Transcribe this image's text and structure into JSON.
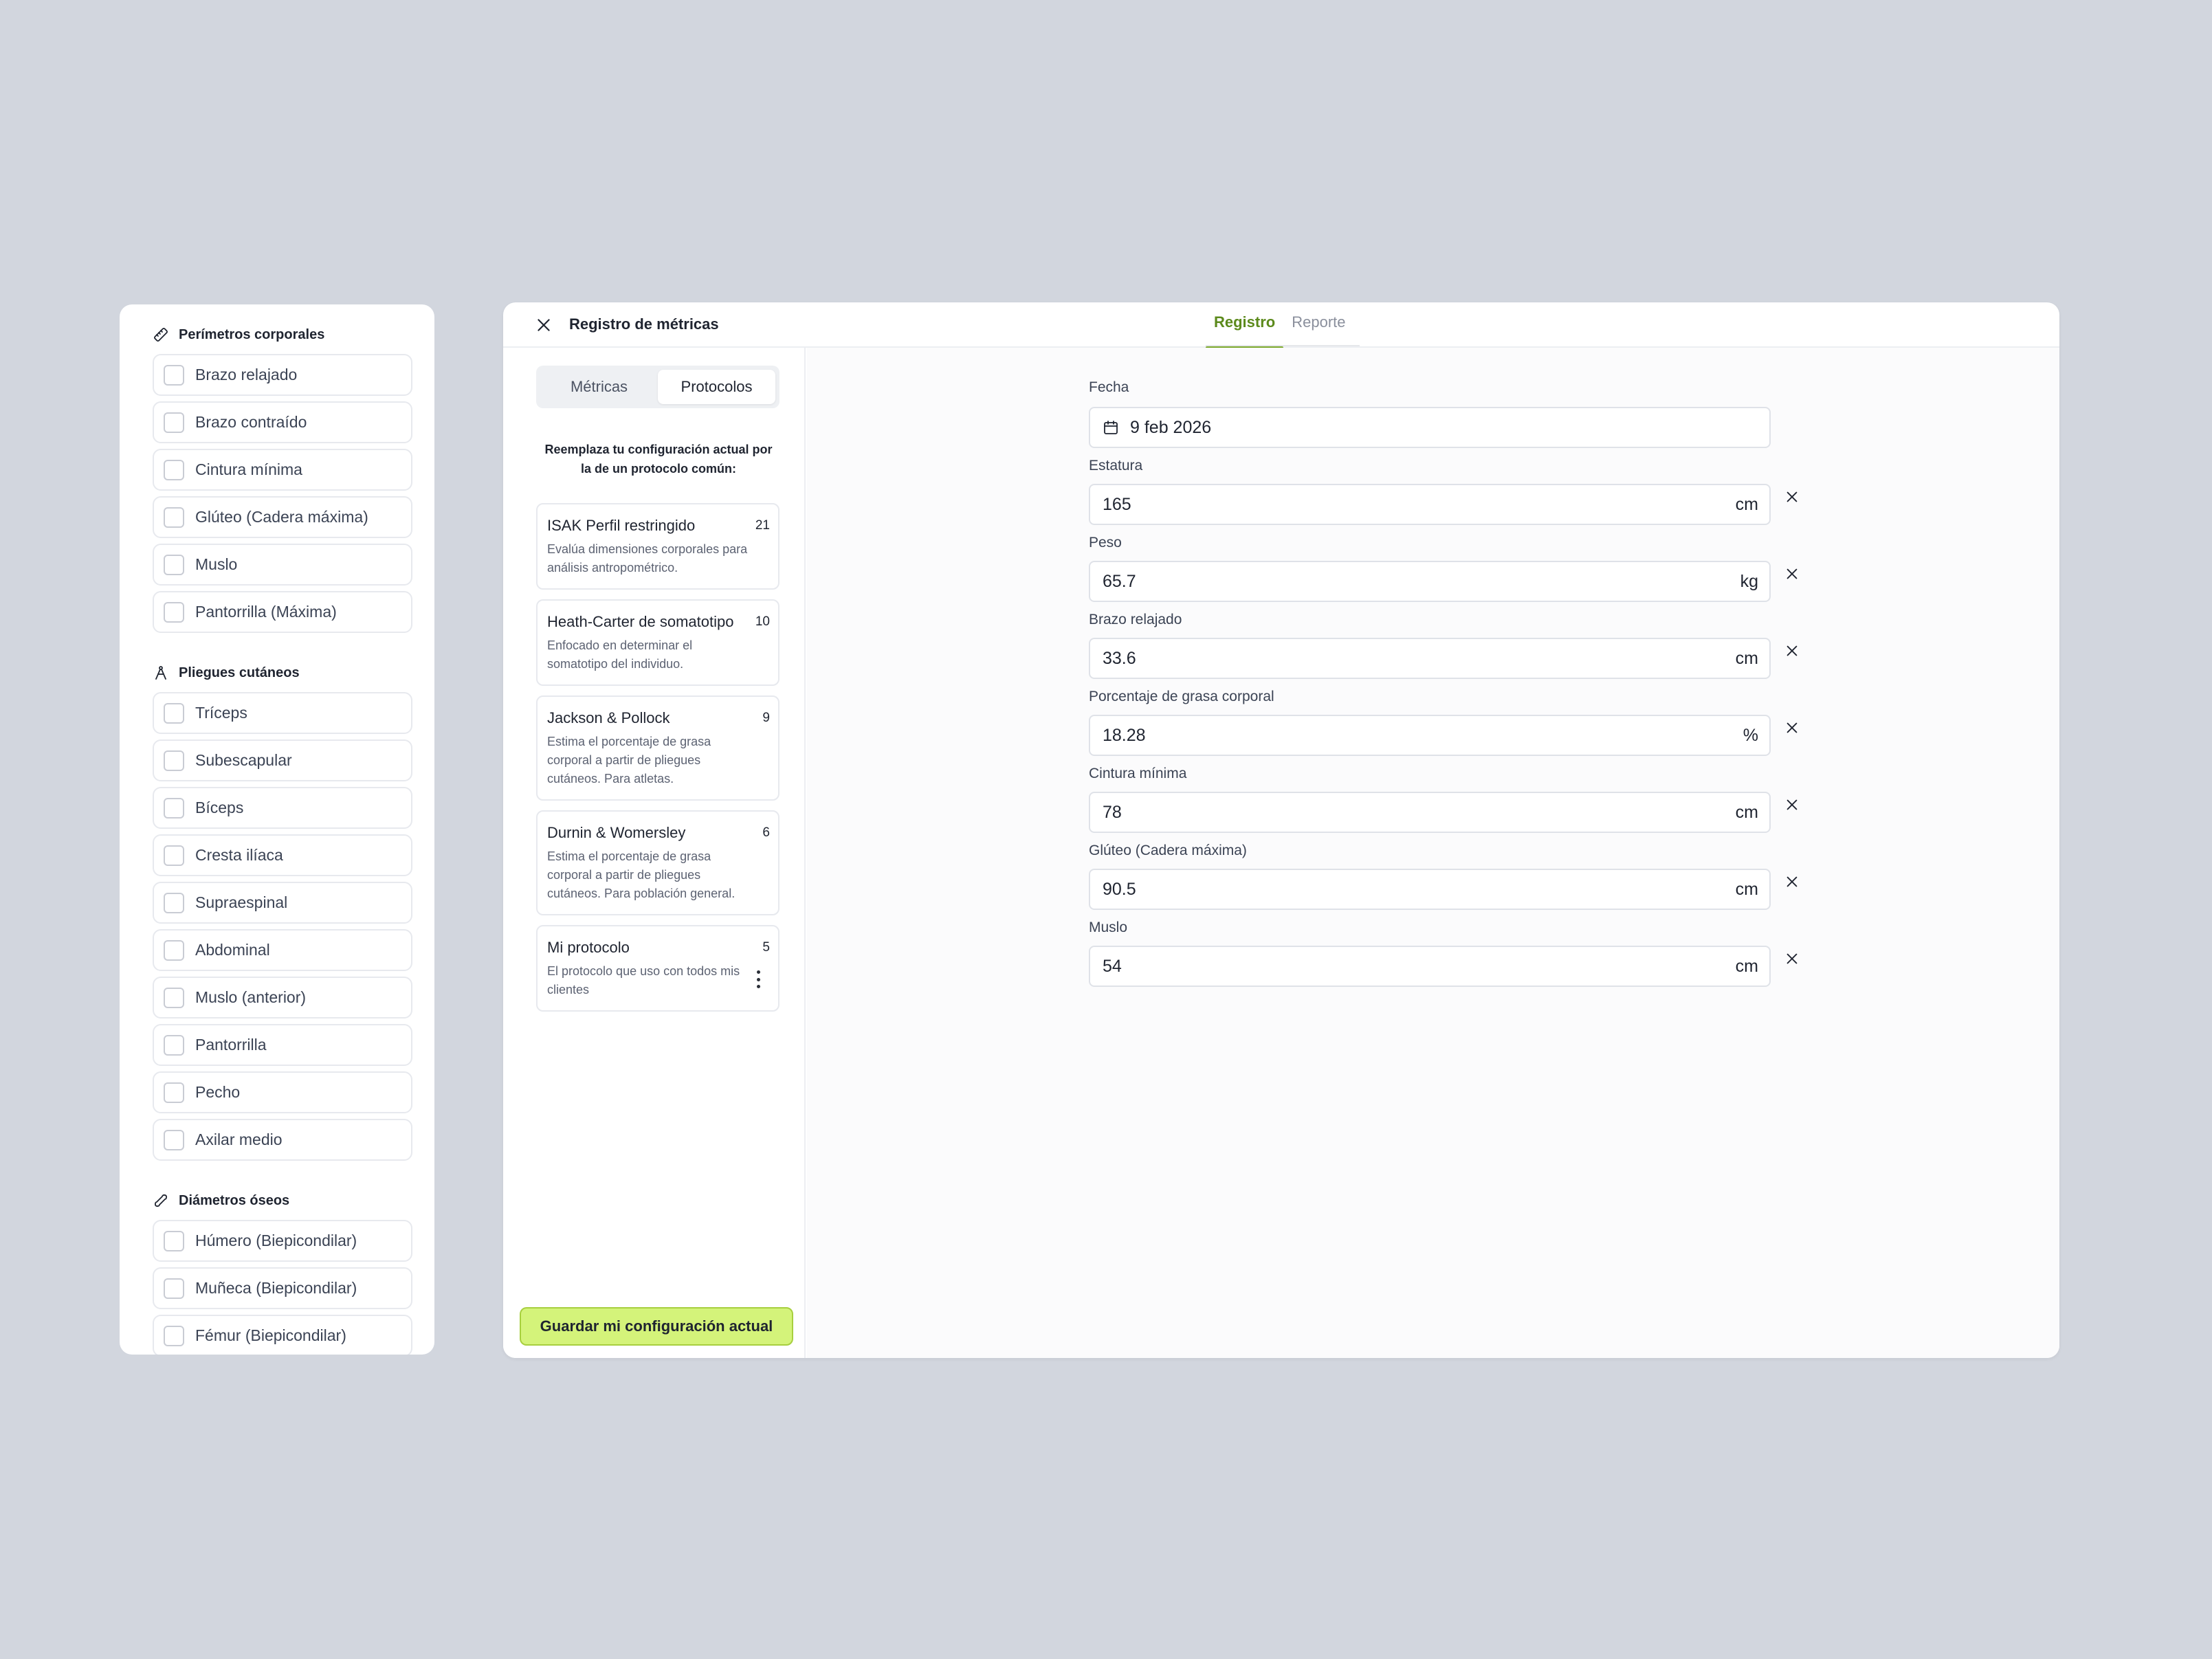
{
  "left_panel": {
    "groups": [
      {
        "title": "Perímetros corporales",
        "icon": "ruler-icon",
        "items": [
          "Brazo relajado",
          "Brazo contraído",
          "Cintura mínima",
          "Glúteo (Cadera máxima)",
          "Muslo",
          "Pantorrilla (Máxima)"
        ]
      },
      {
        "title": "Pliegues cutáneos",
        "icon": "caliper-icon",
        "items": [
          "Tríceps",
          "Subescapular",
          "Bíceps",
          "Cresta ilíaca",
          "Supraespinal",
          "Abdominal",
          "Muslo (anterior)",
          "Pantorrilla",
          "Pecho",
          "Axilar medio"
        ]
      },
      {
        "title": "Diámetros óseos",
        "icon": "bone-icon",
        "items": [
          "Húmero (Biepicondilar)",
          "Muñeca (Biepicondilar)",
          "Fémur (Biepicondilar)"
        ]
      }
    ]
  },
  "main": {
    "title": "Registro de métricas",
    "tabs": [
      {
        "label": "Registro",
        "active": true
      },
      {
        "label": "Reporte",
        "active": false
      }
    ],
    "sidebar": {
      "segments": [
        {
          "label": "Métricas",
          "active": false
        },
        {
          "label": "Protocolos",
          "active": true
        }
      ],
      "intro": "Reemplaza tu configuración actual por la de un protocolo común:",
      "protocols": [
        {
          "name": "ISAK Perfil restringido",
          "count": "21",
          "desc": "Evalúa dimensiones corporales para análisis antropométrico."
        },
        {
          "name": "Heath-Carter de somatotipo",
          "count": "10",
          "desc": "Enfocado en determinar el somatotipo del individuo."
        },
        {
          "name": "Jackson & Pollock",
          "count": "9",
          "desc": "Estima el porcentaje de grasa corporal a partir de pliegues cutáneos. Para atletas."
        },
        {
          "name": "Durnin & Womersley",
          "count": "6",
          "desc": "Estima el porcentaje de grasa corporal a partir de pliegues cutáneos. Para población general."
        },
        {
          "name": "Mi protocolo",
          "count": "5",
          "desc": "El protocolo que uso con todos mis clientes"
        }
      ],
      "save_label": "Guardar mi configuración actual"
    },
    "form": {
      "date_label": "Fecha",
      "date_value": "9 feb 2026",
      "fields": [
        {
          "label": "Estatura",
          "value": "165",
          "unit": "cm"
        },
        {
          "label": "Peso",
          "value": "65.7",
          "unit": "kg"
        },
        {
          "label": "Brazo relajado",
          "value": "33.6",
          "unit": "cm"
        },
        {
          "label": "Porcentaje de grasa corporal",
          "value": "18.28",
          "unit": "%"
        },
        {
          "label": "Cintura mínima",
          "value": "78",
          "unit": "cm"
        },
        {
          "label": "Glúteo (Cadera máxima)",
          "value": "90.5",
          "unit": "cm"
        },
        {
          "label": "Muslo",
          "value": "54",
          "unit": "cm"
        }
      ]
    }
  },
  "colors": {
    "accent": "#7aa82a",
    "save_button": "#d4f37a",
    "background": "#d2d6de"
  }
}
